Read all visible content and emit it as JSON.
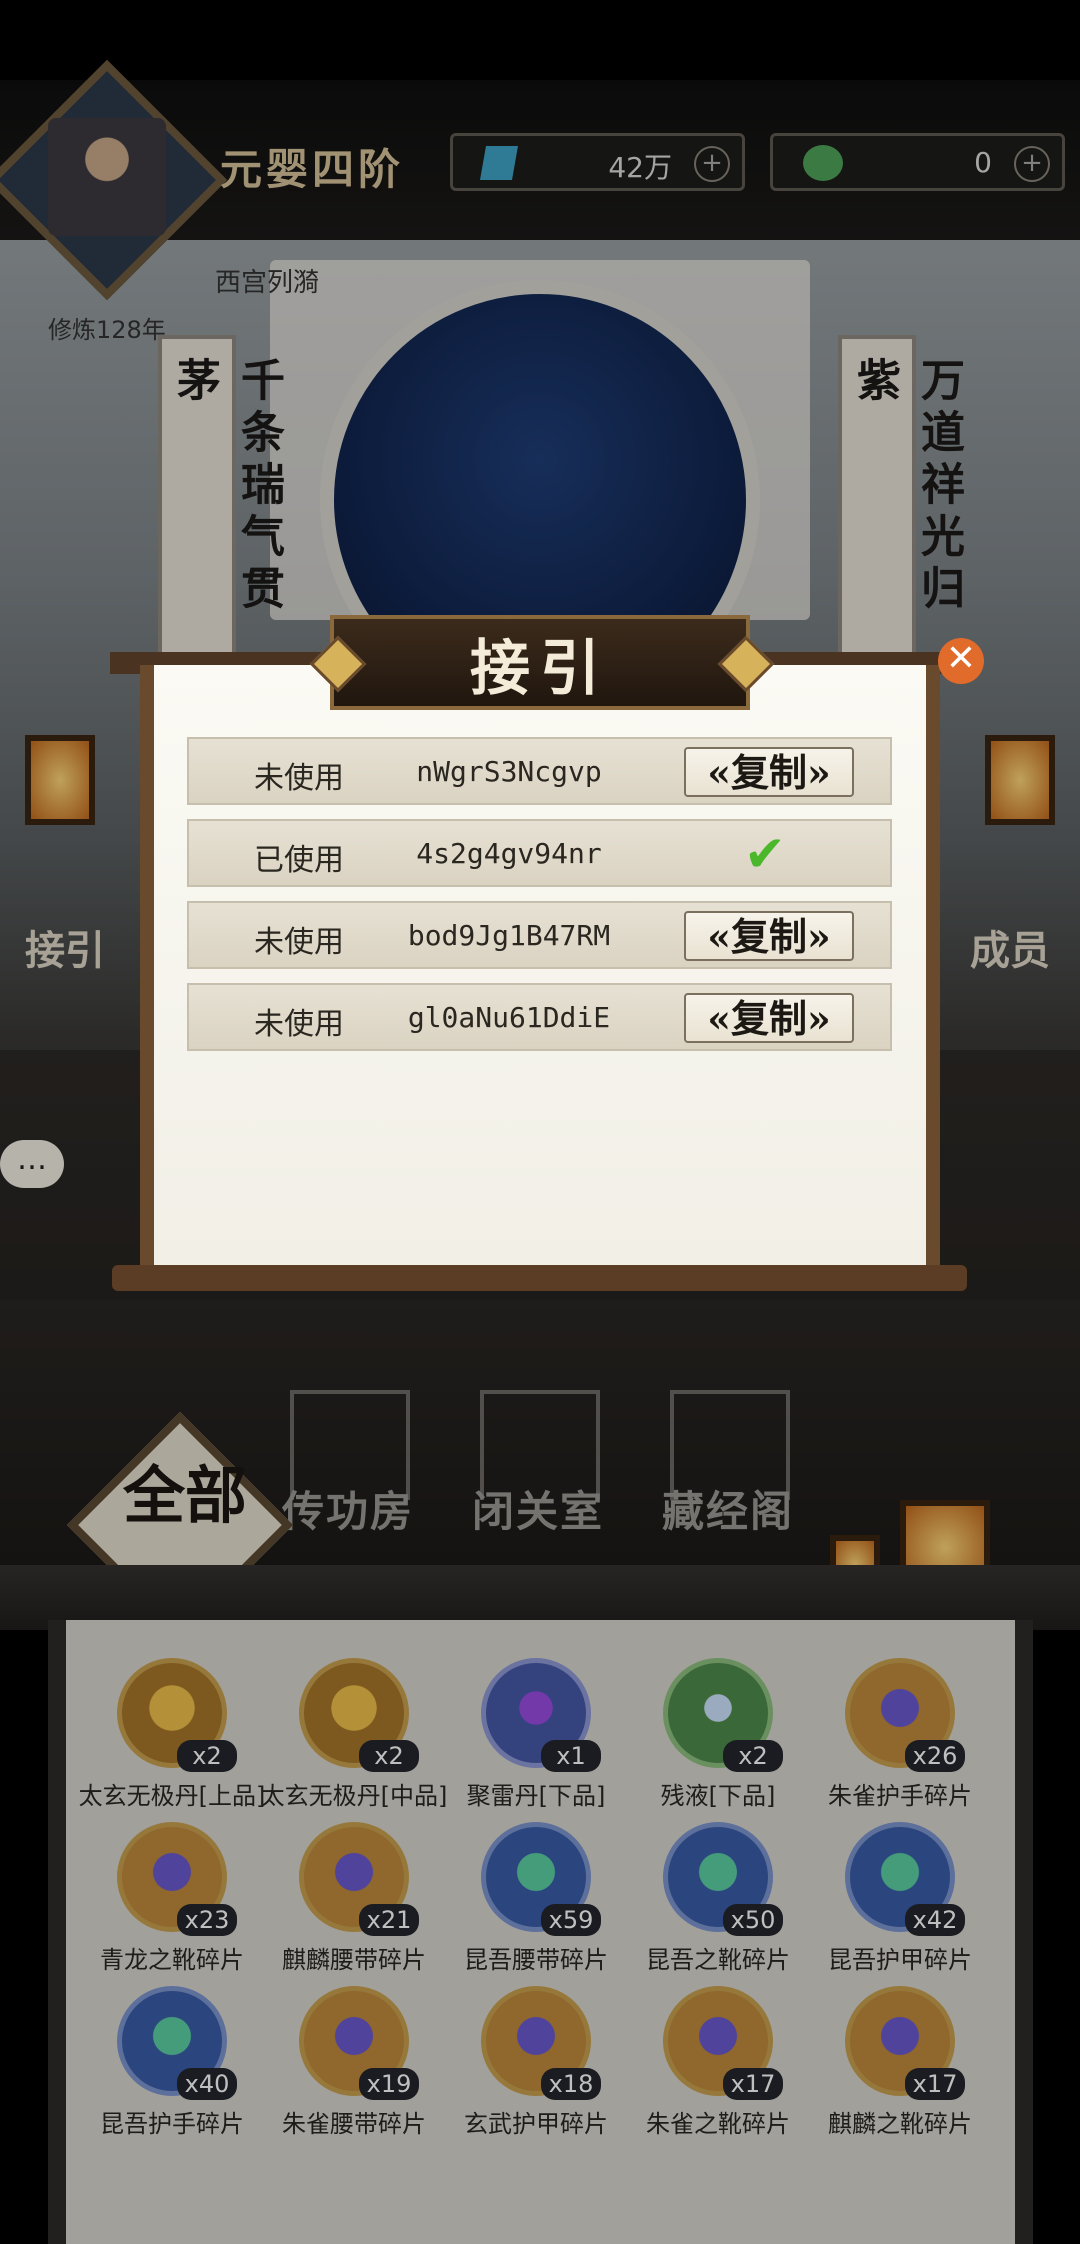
{
  "header": {
    "realm": "元婴四阶",
    "resources": [
      {
        "icon": "spirit-stone-icon",
        "value": "42万"
      },
      {
        "icon": "jade-icon",
        "value": "0"
      }
    ],
    "player_name": "西宫列漪",
    "cultivation": "修炼128年"
  },
  "scene": {
    "couplet_left": "千条瑞气贯茅",
    "couplet_right": "万道祥光归紫",
    "left_label": "接引",
    "right_label": "成员"
  },
  "modal": {
    "title": "接引",
    "rows": [
      {
        "status": "未使用",
        "code": "nWgrS3Ncgvp",
        "action": "复制"
      },
      {
        "status": "已使用",
        "code": "4s2g4gv94nr",
        "action": ""
      },
      {
        "status": "未使用",
        "code": "bod9Jg1B47RM",
        "action": "复制"
      },
      {
        "status": "未使用",
        "code": "gl0aNu61DdiE",
        "action": "复制"
      }
    ]
  },
  "buildings": {
    "all_label": "全部",
    "items": [
      "传功房",
      "闭关室",
      "藏经阁"
    ]
  },
  "inventory": [
    {
      "name": "太玄无极丹[上品]",
      "count": "x2",
      "style": "gold"
    },
    {
      "name": "太玄无极丹[中品]",
      "count": "x2",
      "style": "gold"
    },
    {
      "name": "聚雷丹[下品]",
      "count": "x1",
      "style": "purple"
    },
    {
      "name": "残液[下品]",
      "count": "x2",
      "style": "green"
    },
    {
      "name": "朱雀护手碎片",
      "count": "x26",
      "style": "gold-frag"
    },
    {
      "name": "青龙之靴碎片",
      "count": "x23",
      "style": "gold-frag"
    },
    {
      "name": "麒麟腰带碎片",
      "count": "x21",
      "style": "gold-frag"
    },
    {
      "name": "昆吾腰带碎片",
      "count": "x59",
      "style": "blue"
    },
    {
      "name": "昆吾之靴碎片",
      "count": "x50",
      "style": "blue"
    },
    {
      "name": "昆吾护甲碎片",
      "count": "x42",
      "style": "blue"
    },
    {
      "name": "昆吾护手碎片",
      "count": "x40",
      "style": "blue"
    },
    {
      "name": "朱雀腰带碎片",
      "count": "x19",
      "style": "gold-frag"
    },
    {
      "name": "玄武护甲碎片",
      "count": "x18",
      "style": "gold-frag"
    },
    {
      "name": "朱雀之靴碎片",
      "count": "x17",
      "style": "gold-frag"
    },
    {
      "name": "麒麟之靴碎片",
      "count": "x17",
      "style": "gold-frag"
    }
  ],
  "chat_label": "…"
}
